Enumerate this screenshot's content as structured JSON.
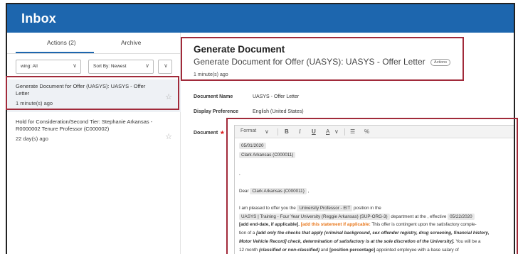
{
  "header": {
    "title": "Inbox"
  },
  "left_panel": {
    "tabs": [
      {
        "label": "Actions (2)",
        "selected": true
      },
      {
        "label": "Archive",
        "selected": false
      }
    ],
    "filters": {
      "group": "wing: All",
      "sort": "Sort By: Newest"
    },
    "items": [
      {
        "title": "Generate Document for Offer (UASYS): UASYS - Offer Letter",
        "time": "1 minute(s) ago",
        "selected": true
      },
      {
        "title": "Hold for Consideration/Second Tier: Stephanie Arkansas - R0000002 Tenure Professor (C000002)",
        "time": "22 day(s) ago",
        "selected": false
      }
    ]
  },
  "detail": {
    "title": "Generate Document",
    "subtitle": "Generate Document for Offer (UASYS): UASYS - Offer Letter",
    "actions_badge": "Actions",
    "time": "1 minute(s) ago",
    "fields": {
      "document_name_label": "Document Name",
      "document_name_value": "UASYS - Offer Letter",
      "display_pref_label": "Display Preference",
      "display_pref_value": "English (United States)",
      "document_label": "Document",
      "required_mark": "★"
    },
    "editor": {
      "toolbar": {
        "format": "Format",
        "bold": "B",
        "italic": "I",
        "underline": "U",
        "color": "A",
        "chevron": "∨",
        "list": "☰",
        "link": "%"
      },
      "date": "05/01/2020",
      "addressee": "Clark Arkansas (C000011)",
      "comma": ",",
      "greeting": "Dear",
      "greeting_name": "Clark Arkansas (C000011)",
      "greeting_comma": ",",
      "p1_intro": "I am pleased to offer you the",
      "position": "University Professor - EIT",
      "p1_mid": "position in the",
      "org": "UASYS | Training - Four Year University (Reggie Arkansas) (SUP-ORG-3)",
      "p1_mid2": "department at the , effective",
      "effective_date": "05/22/2020",
      "p2_end_date": "[add end-date, if applicable].",
      "p2_statement": "[add this statement if applicable:",
      "p2_rest": "This offer is contingent upon the satisfactory comple-",
      "p3_start": "tion of a",
      "p3_checks": "[add only the checks that apply (criminal background, sex offender registry, drug screening, financial history,",
      "p4_checks": "Motor Vehicle Record] check, determination of satisfactory is at the sole discretion of the University].",
      "p4_rest": "You will be a",
      "p5_start": "12 month",
      "p5_class": "(classified or non-classified)",
      "p5_and": "and",
      "p5_pct": "[position percentage]",
      "p5_rest": "appointed employee with a base salary of"
    }
  },
  "colors": {
    "brand": "#1d66ae",
    "highlight": "#a12a3a",
    "orange": "#e8761a"
  },
  "icons": [
    "star-icon",
    "chevron-down-icon",
    "bold-icon",
    "italic-icon",
    "underline-icon",
    "font-color-icon",
    "list-icon",
    "link-icon"
  ]
}
